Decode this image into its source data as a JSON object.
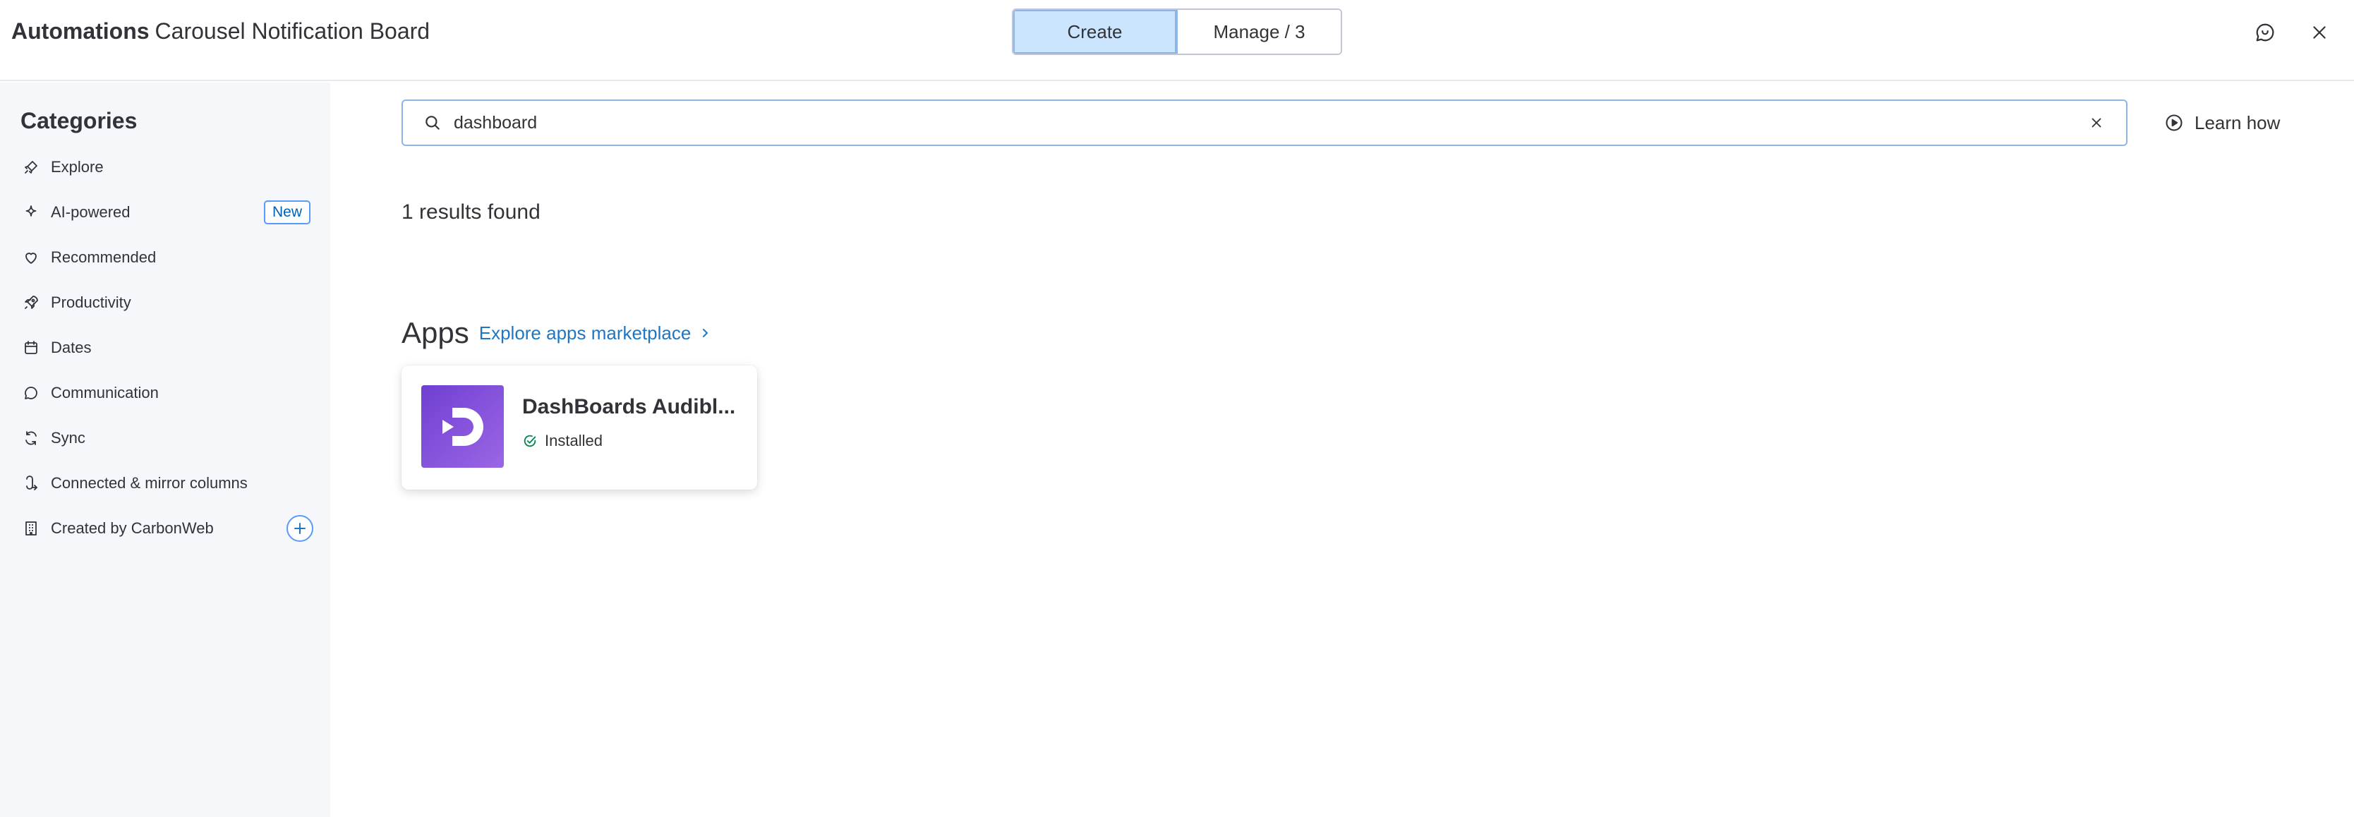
{
  "header": {
    "title_strong": "Automations",
    "title_board": "Carousel Notification Board",
    "tabs": [
      {
        "label": "Create",
        "active": true
      },
      {
        "label": "Manage / 3",
        "active": false
      }
    ],
    "icons": [
      "feedback-chat-icon",
      "close-icon"
    ]
  },
  "sidebar": {
    "title": "Categories",
    "items": [
      {
        "label": "Explore",
        "icon": "rocket-icon"
      },
      {
        "label": "AI-powered",
        "icon": "sparkle-icon",
        "badge": "New"
      },
      {
        "label": "Recommended",
        "icon": "heart-icon"
      },
      {
        "label": "Productivity",
        "icon": "rocket-launch-icon"
      },
      {
        "label": "Dates",
        "icon": "calendar-icon"
      },
      {
        "label": "Communication",
        "icon": "chat-bubble-icon"
      },
      {
        "label": "Sync",
        "icon": "sync-icon"
      },
      {
        "label": "Connected & mirror columns",
        "icon": "connect-icon"
      },
      {
        "label": "Created by CarbonWeb",
        "icon": "building-icon",
        "action": "add"
      }
    ]
  },
  "search": {
    "value": "dashboard",
    "placeholder": "Search"
  },
  "learn_how": "Learn how",
  "results_text": "1 results found",
  "apps": {
    "heading": "Apps",
    "marketplace_link": "Explore apps marketplace",
    "items": [
      {
        "name": "DashBoards Audibl...",
        "status": "Installed",
        "logo": "dashboards-logo"
      }
    ]
  },
  "colors": {
    "accent": "#0073ea",
    "active_tab_bg": "#cce5ff",
    "link": "#1f76c2",
    "sidebar_bg": "#f6f7fb",
    "logo_purple": "#7a48d8",
    "installed_green": "#00854d"
  }
}
